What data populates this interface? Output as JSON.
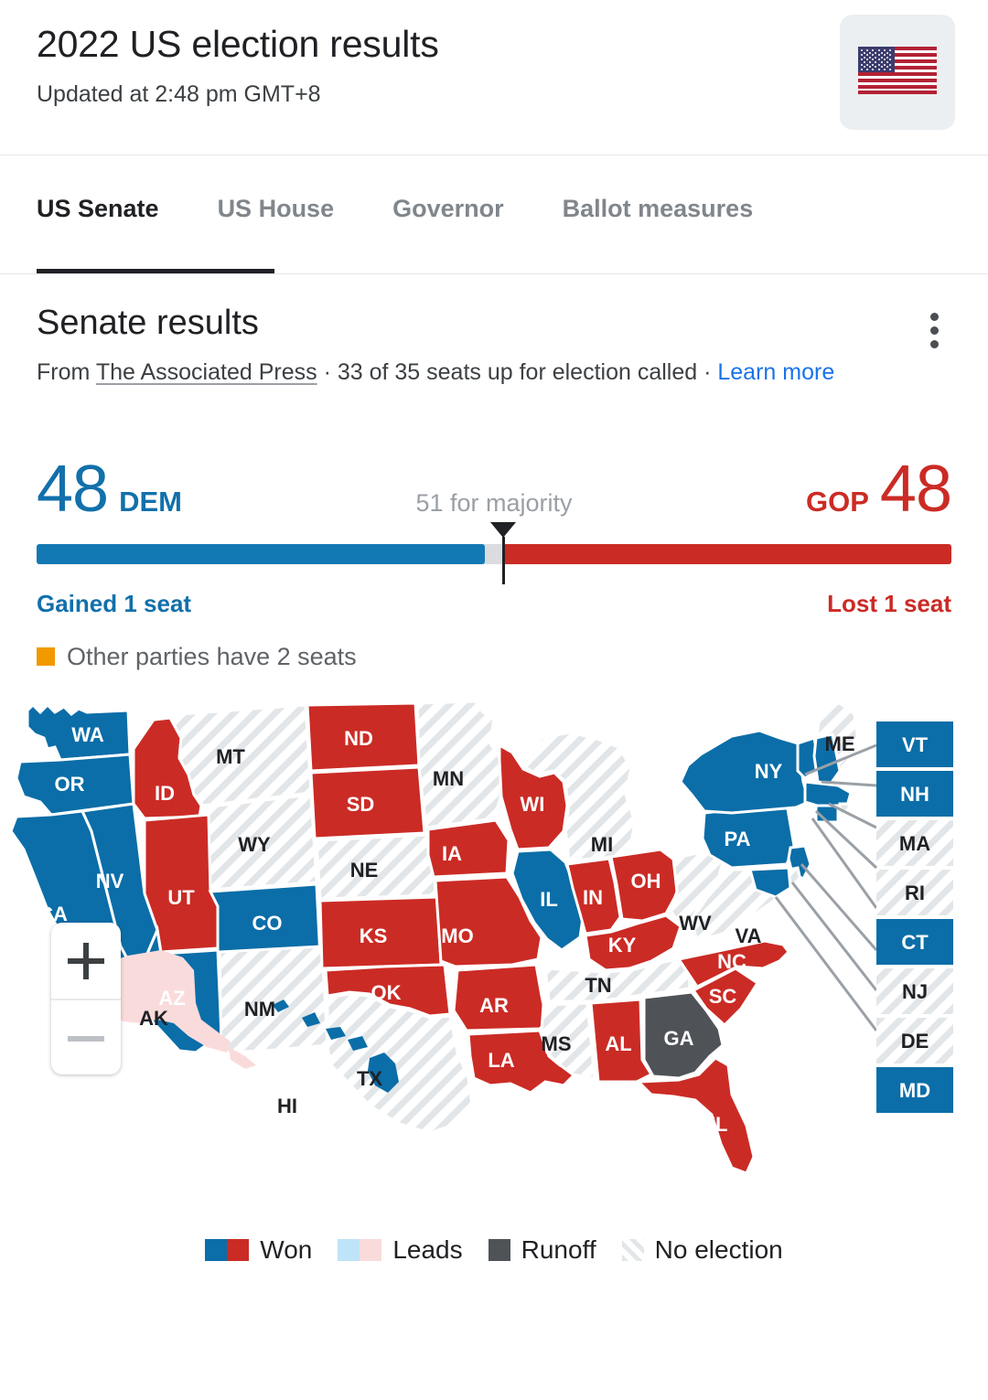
{
  "header": {
    "title": "2022 US election results",
    "updated": "Updated at 2:48 pm GMT+8",
    "flag_icon": "us-flag-icon"
  },
  "tabs": [
    {
      "label": "US Senate",
      "active": true
    },
    {
      "label": "US House",
      "active": false
    },
    {
      "label": "Governor",
      "active": false
    },
    {
      "label": "Ballot measures",
      "active": false
    }
  ],
  "results": {
    "title": "Senate results",
    "source_prefix": "From ",
    "source_name": "The Associated Press",
    "source_middle": " · 33 of 35 seats up for election called · ",
    "learn_more": "Learn more",
    "menu_icon": "kebab-menu-icon"
  },
  "tally": {
    "dem_seats": "48",
    "dem_label": "DEM",
    "gop_seats": "48",
    "gop_label": "GOP",
    "majority_note": "51 for majority",
    "dem_delta": "Gained 1 seat",
    "gop_delta": "Lost 1 seat",
    "other_parties": "Other parties have 2 seats",
    "dem_color": "#1379b4",
    "gop_color": "#cb2b25",
    "other_color": "#f29900",
    "track_color": "#dadce0"
  },
  "zoom_controls": {
    "zoom_in": "+",
    "zoom_out": "−"
  },
  "legend": [
    {
      "label": "Won",
      "swatches": [
        "#0b6ea8",
        "#cb2b25"
      ],
      "pattern": false
    },
    {
      "label": "Leads",
      "swatches": [
        "#bfe3f7",
        "#fadbdb"
      ],
      "pattern": false
    },
    {
      "label": "Runoff",
      "swatches": [
        "#4f5358"
      ],
      "pattern": false
    },
    {
      "label": "No election",
      "swatches": [],
      "pattern": true
    }
  ],
  "chart_data": {
    "type": "map",
    "title": "Senate results",
    "subtitle": "33 of 35 seats up for election called",
    "total_dem": 48,
    "total_gop": 48,
    "total_other": 2,
    "majority_threshold": 51,
    "status_colors": {
      "dem_won": "#0b6ea8",
      "gop_won": "#cb2b25",
      "dem_leads": "#bfe3f7",
      "gop_leads": "#fadbdb",
      "runoff": "#4f5358",
      "no_election": "#e8eaed"
    },
    "states": [
      {
        "code": "WA",
        "status": "dem_won"
      },
      {
        "code": "OR",
        "status": "dem_won"
      },
      {
        "code": "CA",
        "status": "dem_won"
      },
      {
        "code": "NV",
        "status": "dem_won"
      },
      {
        "code": "ID",
        "status": "gop_won"
      },
      {
        "code": "MT",
        "status": "no_election"
      },
      {
        "code": "WY",
        "status": "no_election"
      },
      {
        "code": "UT",
        "status": "gop_won"
      },
      {
        "code": "CO",
        "status": "dem_won"
      },
      {
        "code": "AZ",
        "status": "dem_won"
      },
      {
        "code": "NM",
        "status": "no_election"
      },
      {
        "code": "ND",
        "status": "gop_won"
      },
      {
        "code": "SD",
        "status": "gop_won"
      },
      {
        "code": "NE",
        "status": "no_election"
      },
      {
        "code": "KS",
        "status": "gop_won"
      },
      {
        "code": "OK",
        "status": "gop_won"
      },
      {
        "code": "TX",
        "status": "no_election"
      },
      {
        "code": "MN",
        "status": "no_election"
      },
      {
        "code": "IA",
        "status": "gop_won"
      },
      {
        "code": "MO",
        "status": "gop_won"
      },
      {
        "code": "AR",
        "status": "gop_won"
      },
      {
        "code": "LA",
        "status": "gop_won"
      },
      {
        "code": "WI",
        "status": "gop_won"
      },
      {
        "code": "IL",
        "status": "dem_won"
      },
      {
        "code": "IN",
        "status": "gop_won"
      },
      {
        "code": "MI",
        "status": "no_election"
      },
      {
        "code": "OH",
        "status": "gop_won"
      },
      {
        "code": "KY",
        "status": "gop_won"
      },
      {
        "code": "TN",
        "status": "no_election"
      },
      {
        "code": "MS",
        "status": "no_election"
      },
      {
        "code": "AL",
        "status": "gop_won"
      },
      {
        "code": "GA",
        "status": "runoff"
      },
      {
        "code": "FL",
        "status": "gop_won"
      },
      {
        "code": "SC",
        "status": "gop_won"
      },
      {
        "code": "NC",
        "status": "gop_won"
      },
      {
        "code": "WV",
        "status": "no_election"
      },
      {
        "code": "VA",
        "status": "no_election"
      },
      {
        "code": "PA",
        "status": "dem_won"
      },
      {
        "code": "NY",
        "status": "dem_won"
      },
      {
        "code": "ME",
        "status": "no_election"
      },
      {
        "code": "VT",
        "status": "dem_won"
      },
      {
        "code": "NH",
        "status": "dem_won"
      },
      {
        "code": "MA",
        "status": "no_election"
      },
      {
        "code": "RI",
        "status": "no_election"
      },
      {
        "code": "CT",
        "status": "dem_won"
      },
      {
        "code": "NJ",
        "status": "no_election"
      },
      {
        "code": "DE",
        "status": "no_election"
      },
      {
        "code": "MD",
        "status": "dem_won"
      },
      {
        "code": "AK",
        "status": "gop_leads"
      },
      {
        "code": "HI",
        "status": "dem_won"
      }
    ],
    "callout_boxes": [
      "VT",
      "NH",
      "MA",
      "RI",
      "CT",
      "NJ",
      "DE",
      "MD"
    ]
  }
}
